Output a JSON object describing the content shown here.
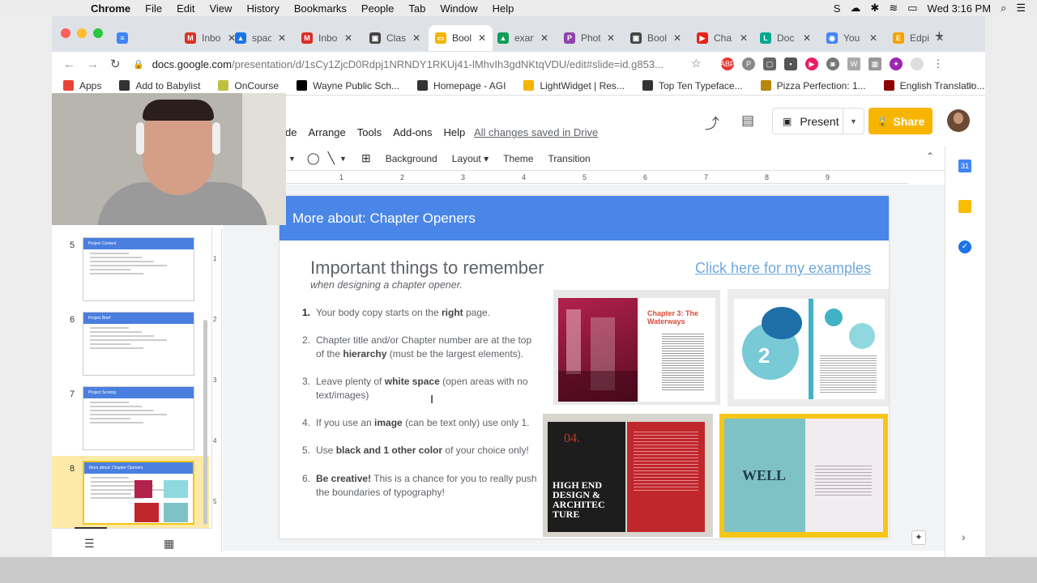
{
  "menubar": {
    "app": "Chrome",
    "items": [
      "File",
      "Edit",
      "View",
      "History",
      "Bookmarks",
      "People",
      "Tab",
      "Window",
      "Help"
    ],
    "clock": "Wed 3:16 PM"
  },
  "tabs": [
    {
      "label": "Inbo",
      "color": "#d93025",
      "glyph": "M"
    },
    {
      "label": "spac",
      "color": "#1a73e8",
      "glyph": "▲"
    },
    {
      "label": "Inbo",
      "color": "#d93025",
      "glyph": "M"
    },
    {
      "label": "Clas",
      "color": "#444444",
      "glyph": "▣"
    },
    {
      "label": "Bool",
      "color": "#f4b400",
      "glyph": "▭",
      "active": true
    },
    {
      "label": "exan",
      "color": "#0f9d58",
      "glyph": "▲"
    },
    {
      "label": "Phot",
      "color": "#8e44ad",
      "glyph": "P"
    },
    {
      "label": "Bool",
      "color": "#444444",
      "glyph": "▣"
    },
    {
      "label": "Cha",
      "color": "#e62117",
      "glyph": "▶"
    },
    {
      "label": "Doc",
      "color": "#00a98f",
      "glyph": "L"
    },
    {
      "label": "You",
      "color": "#4285f4",
      "glyph": "◉"
    },
    {
      "label": "Edpi",
      "color": "#f4a300",
      "glyph": "E"
    }
  ],
  "address": {
    "host": "docs.google.com",
    "path": "/presentation/d/1sCy1ZjcD0Rdpj1NRNDY1RKUj41-lMhvIh3gdNKtqVDU/edit#slide=id.g853..."
  },
  "bookmarks": [
    {
      "label": "Apps",
      "color": "#ea4335"
    },
    {
      "label": "Add to Babylist",
      "color": "#333333"
    },
    {
      "label": "OnCourse",
      "color": "#c0c040"
    },
    {
      "label": "Wayne Public Sch...",
      "color": "#000000"
    },
    {
      "label": "Homepage - AGI",
      "color": "#333333"
    },
    {
      "label": "LightWidget | Res...",
      "color": "#f4b400"
    },
    {
      "label": "Top Ten Typeface...",
      "color": "#333333"
    },
    {
      "label": "Pizza Perfection: 1...",
      "color": "#b8860b"
    },
    {
      "label": "English Translatio...",
      "color": "#8b0000"
    }
  ],
  "docs": {
    "menu": [
      "de",
      "Arrange",
      "Tools",
      "Add-ons",
      "Help"
    ],
    "saved_status": "All changes saved in Drive",
    "present_label": "Present",
    "share_label": "Share",
    "toolbar": [
      "Background",
      "Layout ▾",
      "Theme",
      "Transition"
    ]
  },
  "ruler": [
    "1",
    "2",
    "3",
    "4",
    "5",
    "6",
    "7",
    "8",
    "9"
  ],
  "vruler": [
    "1",
    "2",
    "3",
    "4",
    "5"
  ],
  "filmstrip": [
    {
      "num": "5",
      "title": "Project Content"
    },
    {
      "num": "6",
      "title": "Project Brief"
    },
    {
      "num": "7",
      "title": "Project Scoring"
    },
    {
      "num": "8",
      "title": "More about: Chapter Openers",
      "selected": true
    }
  ],
  "slide": {
    "header": "More about: Chapter Openers",
    "title": "Important things to remember",
    "subtitle": "when designing a chapter opener.",
    "link": "Click here for my examples",
    "items": [
      {
        "num": "1.",
        "pre": "Your body copy starts on the ",
        "bold": "right",
        "post": " page."
      },
      {
        "num": "2.",
        "pre": "Chapter title and/or Chapter number are at the top of the ",
        "bold": "hierarchy",
        "post": " (must be the largest elements)."
      },
      {
        "num": "3.",
        "pre": "Leave plenty of ",
        "bold": "white space",
        "post": " (open areas with no text/images)"
      },
      {
        "num": "4.",
        "pre": "If you use an ",
        "bold": "image",
        "post": " (can be text only) use only 1."
      },
      {
        "num": "5.",
        "pre": "Use ",
        "bold": "black and 1 other color",
        "post": " of your choice only!"
      },
      {
        "num": "6.",
        "pre": "",
        "bold": "Be creative!",
        "post": " This is a chance for you to really push the boundaries of typography!"
      }
    ],
    "images": {
      "img1_title": "Chapter 3: The Waterways",
      "img3_number": "04.",
      "img3_title": "HIGH END DESIGN & ARCHITEC TURE",
      "img4_title": "WELL"
    }
  }
}
